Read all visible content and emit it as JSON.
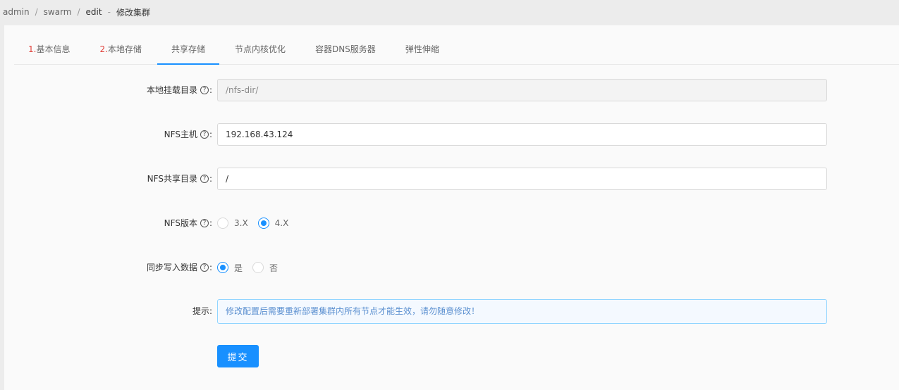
{
  "breadcrumb": {
    "items": [
      "admin",
      "swarm",
      "edit"
    ],
    "separator": "/",
    "current_prefix": "-",
    "current": "修改集群"
  },
  "tabs": [
    {
      "num": "1.",
      "label": "基本信息"
    },
    {
      "num": "2.",
      "label": "本地存储"
    },
    {
      "num": "",
      "label": "共享存储"
    },
    {
      "num": "",
      "label": "节点内核优化"
    },
    {
      "num": "",
      "label": "容器DNS服务器"
    },
    {
      "num": "",
      "label": "弹性伸缩"
    }
  ],
  "active_tab": "共享存储",
  "form": {
    "help_icon": "?",
    "colon": ":",
    "mount_dir": {
      "label": "本地挂载目录",
      "value": "/nfs-dir/",
      "disabled": true
    },
    "nfs_host": {
      "label": "NFS主机",
      "value": "192.168.43.124"
    },
    "nfs_share_dir": {
      "label": "NFS共享目录",
      "value": "/"
    },
    "nfs_version": {
      "label": "NFS版本",
      "options": [
        "3.X",
        "4.X"
      ],
      "selected": "4.X"
    },
    "sync_write": {
      "label": "同步写入数据",
      "options": [
        "是",
        "否"
      ],
      "selected": "是"
    },
    "hint": {
      "label": "提示:",
      "text": "修改配置后需要重新部署集群内所有节点才能生效，请勿随意修改！"
    },
    "submit_label": "提交"
  },
  "colors": {
    "primary": "#1890ff",
    "tab_number": "#e0403a",
    "hint_text": "#5a8fd0"
  }
}
